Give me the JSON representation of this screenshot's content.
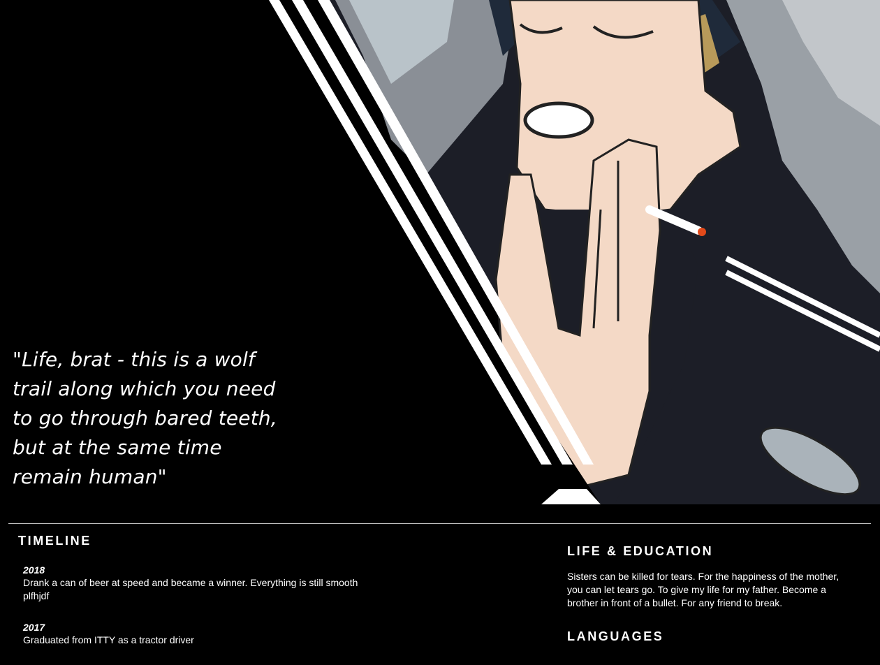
{
  "hero": {
    "quote": "\"Life, brat - this is a wolf trail along which you need to go through bared teeth, but at the same time remain human\""
  },
  "timeline": {
    "title": "TIMELINE",
    "items": [
      {
        "year": "2018",
        "text": "Drank a can of beer at speed and became a winner. Everything is still smooth plfhjdf"
      },
      {
        "year": "2017",
        "text": "Graduated from ITTY as a tractor driver"
      }
    ]
  },
  "life": {
    "title": "LIFE & EDUCATION",
    "text": "Sisters can be killed for tears. For the happiness of the mother, you can let tears go. To give my life for my father. Become a brother in front of a bullet. For any friend to break."
  },
  "languages": {
    "title": "LANGUAGES"
  }
}
